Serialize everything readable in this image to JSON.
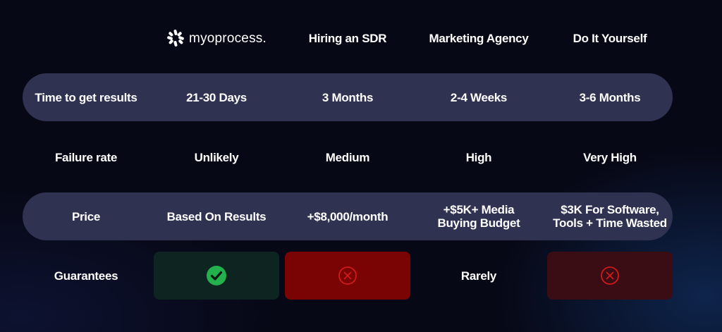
{
  "header": {
    "brand": "myoprocess.",
    "columns": [
      "Hiring an SDR",
      "Marketing Agency",
      "Do It Yourself"
    ]
  },
  "rows": [
    {
      "label": "Time to get results",
      "values": [
        "21-30 Days",
        "3 Months",
        "2-4 Weeks",
        "3-6 Months"
      ]
    },
    {
      "label": "Failure rate",
      "values": [
        "Unlikely",
        "Medium",
        "High",
        "Very High"
      ]
    },
    {
      "label": "Price",
      "values": [
        "Based On Results",
        "+$8,000/month",
        "+$5K+ Media Buying Budget",
        "$3K For Software, Tools + Time Wasted"
      ]
    },
    {
      "label": "Guarantees",
      "values": [
        "check",
        "x",
        "Rarely",
        "x"
      ]
    }
  ],
  "colors": {
    "band": "#2f3250",
    "check": "#22b14c",
    "red_box": "#7a0303",
    "green_box": "#0e2420",
    "dark_red_box": "#3a0d14",
    "x_icon": "#d11a1a"
  },
  "icons": [
    "brand-logo-icon",
    "check-circle-icon",
    "x-circle-icon"
  ]
}
